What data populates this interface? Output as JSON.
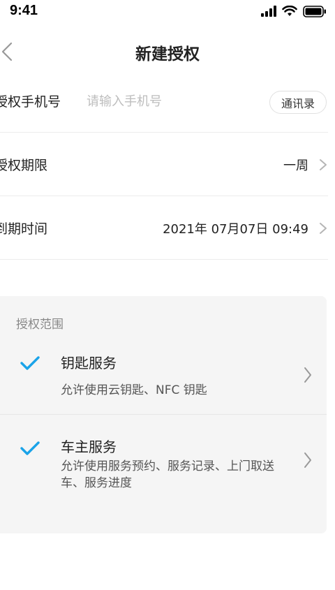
{
  "status": {
    "time": "9:41"
  },
  "nav": {
    "title": "新建授权"
  },
  "form": {
    "phone": {
      "label": "授权手机号",
      "placeholder": "请输入手机号",
      "value": "",
      "contacts_label": "通讯录"
    },
    "period": {
      "label": "授权期限",
      "value": "一周"
    },
    "expiry": {
      "label": "到期时间",
      "value": "2021年 07月07日 09:49"
    }
  },
  "scope": {
    "title": "授权范围",
    "items": [
      {
        "name": "钥匙服务",
        "desc": "允许使用云钥匙、NFC 钥匙",
        "checked": true
      },
      {
        "name": "车主服务",
        "desc": "允许使用服务预约、服务记录、上门取送车、服务进度",
        "checked": true
      }
    ]
  },
  "colors": {
    "accent": "#1aa3e8",
    "card_bg": "#f5f5f5",
    "placeholder": "#bdbdbd"
  },
  "icons": {
    "back": "chevron-left-icon",
    "chevron": "chevron-right-icon",
    "check": "check-icon",
    "signal": "signal-icon",
    "wifi": "wifi-icon",
    "battery": "battery-icon"
  }
}
